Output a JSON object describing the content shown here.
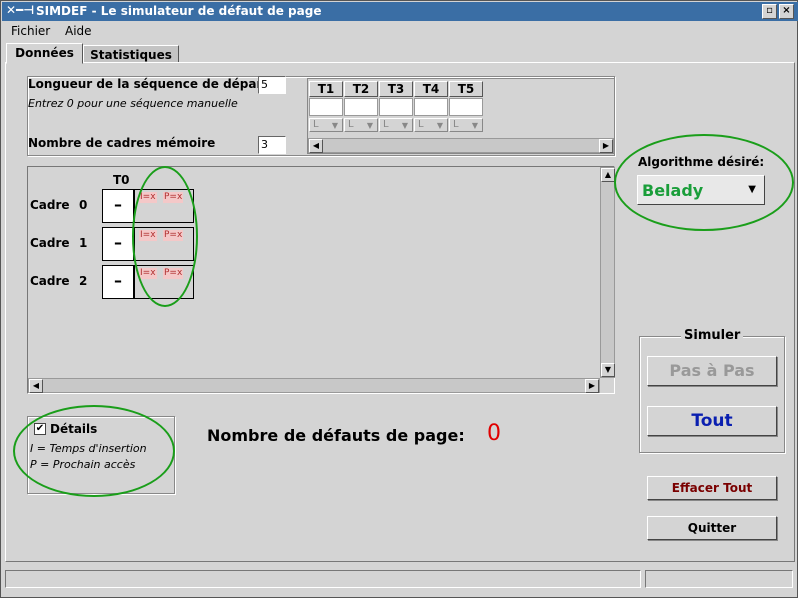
{
  "window": {
    "title": "SIMDEF - Le simulateur de défaut de page",
    "icon": "window-menu-icon"
  },
  "titlebar_buttons": {
    "minimize": "▫",
    "close": "×"
  },
  "menu": [
    "Fichier",
    "Aide"
  ],
  "tabs": [
    {
      "label": "Données",
      "active": true
    },
    {
      "label": "Statistiques",
      "active": false
    }
  ],
  "sequence": {
    "label": "Longueur de la séquence de départ",
    "hint": "Entrez 0 pour une séquence manuelle",
    "value": "5",
    "columns": [
      "T1",
      "T2",
      "T3",
      "T4",
      "T5"
    ],
    "dropdown_value": "L"
  },
  "frames_count": {
    "label": "Nombre de cadres mémoire",
    "value": "3"
  },
  "grid": {
    "column_header": "T0",
    "frames": [
      {
        "label": "Cadre",
        "index": "0",
        "value": "–",
        "chip_i": "I=x",
        "chip_p": "P=x"
      },
      {
        "label": "Cadre",
        "index": "1",
        "value": "–",
        "chip_i": "I=x",
        "chip_p": "P=x"
      },
      {
        "label": "Cadre",
        "index": "2",
        "value": "–",
        "chip_i": "I=x",
        "chip_p": "P=x"
      }
    ]
  },
  "algorithm": {
    "label": "Algorithme désiré:",
    "value": "Belady",
    "color": "#1a9e3a"
  },
  "details": {
    "checkbox_label": "Détails",
    "checked": true,
    "legend_i": "I = Temps d'insertion",
    "legend_p": "P = Prochain accès"
  },
  "faults": {
    "label": "Nombre de défauts de page:",
    "value": "0",
    "color": "#e00000"
  },
  "simulate": {
    "group_label": "Simuler",
    "step_button": "Pas à Pas",
    "all_button": "Tout",
    "all_color": "#0a1fb0"
  },
  "clear_button": {
    "label": "Effacer Tout",
    "color": "#7a0000"
  },
  "quit_button": {
    "label": "Quitter"
  },
  "highlight_color": "#1a9e1a"
}
